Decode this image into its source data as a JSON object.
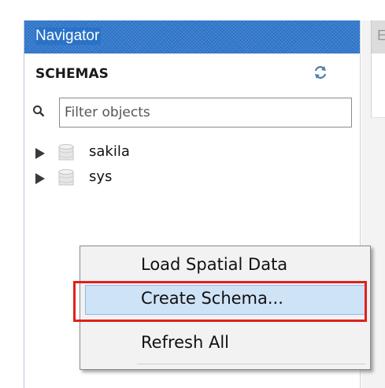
{
  "navigator": {
    "title": "Navigator",
    "schemas_label": "SCHEMAS",
    "refresh_icon": "refresh-icon",
    "search_icon": "search-icon",
    "filter_placeholder": "Filter objects",
    "schemas": [
      {
        "label": "sakila",
        "icon": "database-icon"
      },
      {
        "label": "sys",
        "icon": "database-icon"
      }
    ]
  },
  "right_panel": {
    "tab_label_partial": "E"
  },
  "context_menu": {
    "items": [
      {
        "label": "Load Spatial Data"
      },
      {
        "label": "Create Schema..."
      },
      {
        "label": "Refresh All"
      }
    ],
    "highlighted_item": "Create Schema..."
  },
  "colors": {
    "header_blue": "#2a72c7",
    "menu_highlight": "#cfe3f7",
    "annotation_red": "#e0201e"
  }
}
